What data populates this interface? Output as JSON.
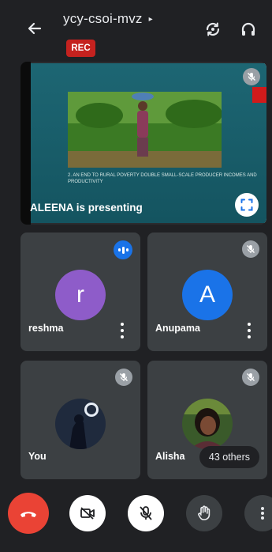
{
  "header": {
    "meeting_code": "ycy-csoi-mvz",
    "caret": "▸",
    "rec_label": "REC"
  },
  "presentation": {
    "slide_caption": "2. AN END TO RURAL POVERTY DOUBLE SMALL-SCALE PRODUCER INCOMES AND PRODUCTIVITY",
    "presenting_label": "ALEENA is presenting"
  },
  "participants": [
    {
      "name": "reshma",
      "avatar_letter": "r",
      "avatar_color": "#8e5cc9",
      "speaking": true
    },
    {
      "name": "Anupama",
      "avatar_letter": "A",
      "avatar_color": "#1a73e8",
      "speaking": false
    },
    {
      "name": "You",
      "avatar_letter": "",
      "speaking": false
    },
    {
      "name": "Alisha",
      "avatar_letter": "",
      "speaking": false
    }
  ],
  "others_label": "43 others",
  "colors": {
    "background": "#202124",
    "tile": "#3c4043",
    "rec": "#c5221f",
    "end_call": "#ea4335",
    "speaking_blue": "#1a73e8"
  },
  "icons": {
    "back": "arrow-left-icon",
    "switch_camera": "camera-switch-icon",
    "audio": "headphones-icon",
    "fullscreen": "fullscreen-icon",
    "mic_off": "mic-off-icon",
    "end_call": "phone-hangup-icon",
    "camera_off": "camera-off-icon",
    "raise_hand": "hand-icon",
    "more": "more-vertical-icon"
  }
}
